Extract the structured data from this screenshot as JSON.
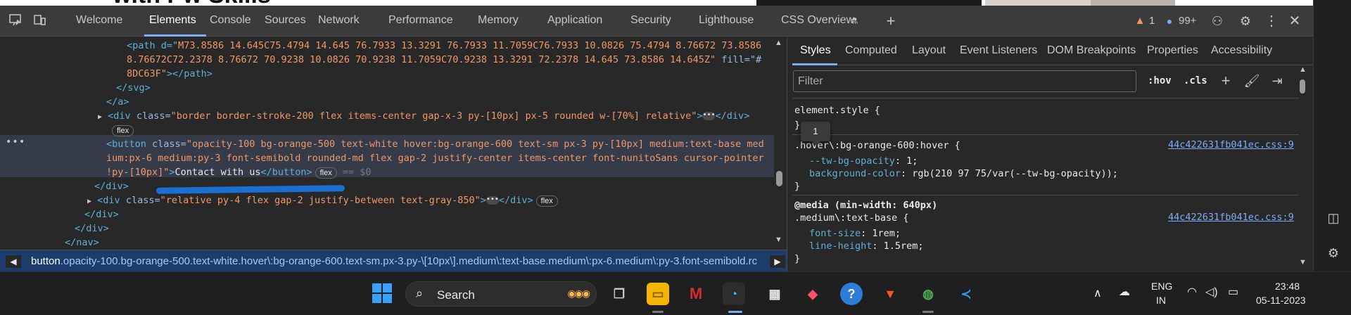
{
  "page_strip": {
    "heading_fragment": "with Pw Skills"
  },
  "devtools": {
    "tabs": [
      {
        "label": "Welcome"
      },
      {
        "label": "Elements"
      },
      {
        "label": "Console"
      },
      {
        "label": "Sources"
      },
      {
        "label": "Network"
      },
      {
        "label": "Performance"
      },
      {
        "label": "Memory"
      },
      {
        "label": "Application"
      },
      {
        "label": "Security"
      },
      {
        "label": "Lighthouse"
      },
      {
        "label": "CSS Overview"
      }
    ],
    "warnings_count": "1",
    "messages_count": "99+",
    "icons": {
      "device": "device-toolbar-icon",
      "inspect": "inspect-icon",
      "add_tab": "plus-icon",
      "feedback": "feedback-icon",
      "settings": "gear-icon",
      "more": "more-vertical-icon",
      "close": "close-icon"
    }
  },
  "elements": {
    "lines": {
      "l1_a": "<path d=\"",
      "l1_val": "M73.8586 14.645C75.4794 14.645 76.7933 13.3291 76.7933 11.7059C76.7933 10.0826 75.4794 8.76672 73.8586",
      "l2": "8.76672C72.2378 8.76672 70.9238 10.0826 70.9238 11.7059C70.9238 13.3291 72.2378 14.645 73.8586 14.645Z\"",
      "l2_fill": " fill=\"#",
      "l3_val": "8DC63F\"",
      "l3_end": "></path>",
      "svg_close": "</svg>",
      "a_close": "</a>",
      "div_open": "<div ",
      "div_class_attr": "class=",
      "div_class_val": "\"border border-stroke-200 flex items-center gap-x-3 py-[10px] px-5 rounded w-[70%] relative\"",
      "div_end": "</div>",
      "flex_badge": "flex",
      "btn_open": "<button ",
      "btn_class_attr": "class=",
      "btn_val_1": "\"opacity-100 bg-orange-500 text-white hover:bg-orange-600 text-sm px-3 py-[10px] medium:text-base med",
      "btn_val_2": "ium:px-6 medium:py-3 font-semibold rounded-md flex gap-2 justify-center items-center font-nunitoSans cursor-pointer",
      "btn_val_3": "!py-[10px]\"",
      "btn_text": "Contact with us",
      "btn_close": "</button>",
      "eq_marker": "== $0",
      "div_close_1": "</div>",
      "div2_class_val": "\"relative py-4 flex gap-2 justify-between text-gray-850\"",
      "div_close_2": "</div>",
      "div_close_3": "</div>",
      "nav_close": "</nav>"
    },
    "breadcrumb_tag": "button",
    "breadcrumb_rest": ".opacity-100.bg-orange-500.text-white.hover\\:bg-orange-600.text-sm.px-3.py-\\[10px\\].medium\\:text-base.medium\\:px-6.medium\\:py-3.font-semibold.rc"
  },
  "styles": {
    "subtabs": [
      {
        "label": "Styles"
      },
      {
        "label": "Computed"
      },
      {
        "label": "Layout"
      },
      {
        "label": "Event Listeners"
      },
      {
        "label": "DOM Breakpoints"
      },
      {
        "label": "Properties"
      },
      {
        "label": "Accessibility"
      }
    ],
    "filter_placeholder": "Filter",
    "hov_label": ":hov",
    "cls_label": ".cls",
    "tooltip": "1",
    "element_style": "element.style {",
    "close_brace": "}",
    "rule1_selector": ".hover\\:bg-orange-600:hover {",
    "rule1_link": "44c422631fb041ec.css:9",
    "rule1_prop1": "--tw-bg-opacity",
    "rule1_val1": ": 1;",
    "rule1_prop2": "background-color",
    "rule1_val2": ": rgb(210 97 75/var(--tw-bg-opacity));",
    "media": "@media (min-width: 640px)",
    "rule2_selector": ".medium\\:text-base {",
    "rule2_link": "44c422631fb041ec.css:9",
    "rule2_prop1": "font-size",
    "rule2_val1": ": 1rem;",
    "rule2_prop2": "line-height",
    "rule2_val2": ": 1.5rem;"
  },
  "taskbar": {
    "search_label": "Search",
    "lang_line1": "ENG",
    "lang_line2": "IN",
    "time": "23:48",
    "date": "05-11-2023",
    "apps": [
      "windows-start-icon",
      "task-view-icon",
      "file-explorer-icon",
      "mcafee-icon",
      "edge-icon",
      "microsoft-store-icon",
      "app-diamond-icon",
      "help-icon",
      "brave-icon",
      "chrome-icon",
      "vscode-icon"
    ]
  },
  "colors": {
    "accent_blue": "#7cacf8",
    "warning_orange": "#f29766",
    "selection_bar": "#1c3d6b"
  }
}
